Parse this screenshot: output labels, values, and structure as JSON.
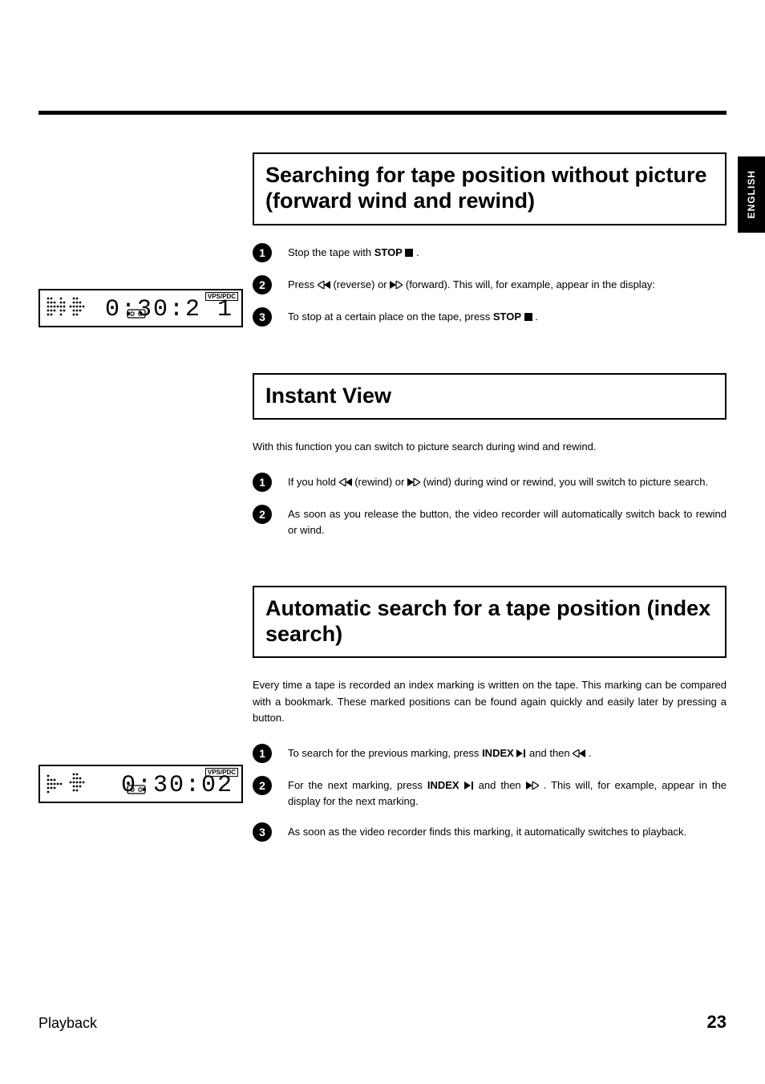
{
  "sidebar_tab": "ENGLISH",
  "section1": {
    "heading": "Searching for tape position without picture (forward wind and rewind)",
    "steps": {
      "s1a": "Stop the tape with ",
      "s1_btn": "STOP",
      "s1b": " .",
      "s2a": "Press ",
      "s2b": " (reverse) or ",
      "s2c": " (forward). This will, for example, appear in the display:",
      "s3a": "To stop at a certain place on the tape, press ",
      "s3_btn": "STOP",
      "s3b": " ."
    }
  },
  "display1": {
    "vps": "VPS/PDC",
    "time": "0:30:2 1"
  },
  "section2": {
    "heading": "Instant View",
    "intro": "With this function you can switch to picture search during wind and rewind.",
    "steps": {
      "s1a": "If you hold ",
      "s1b": " (rewind) or ",
      "s1c": " (wind) during wind or rewind, you will switch to picture search.",
      "s2": "As soon as you release the button, the video recorder will automatically switch back to rewind or wind."
    }
  },
  "section3": {
    "heading": "Automatic search for a tape position (index search)",
    "intro": "Every time a tape is recorded an index marking is written on the tape. This marking can be compared with a bookmark. These marked positions can be found again quickly and easily later by pressing a button.",
    "steps": {
      "s1a": "To search for the previous marking, press ",
      "s1_btn": "INDEX",
      "s1b": " and then ",
      "s1c": " .",
      "s2a": "For the next marking, press ",
      "s2_btn": "INDEX",
      "s2b": " and then ",
      "s2c": " . This will, for example, appear in the display for the next marking.",
      "s3": "As soon as the video recorder finds this marking, it automatically switches to playback."
    }
  },
  "display2": {
    "vps": "VPS/PDC",
    "time": "0:30:02"
  },
  "footer": {
    "section": "Playback",
    "page": "23"
  }
}
